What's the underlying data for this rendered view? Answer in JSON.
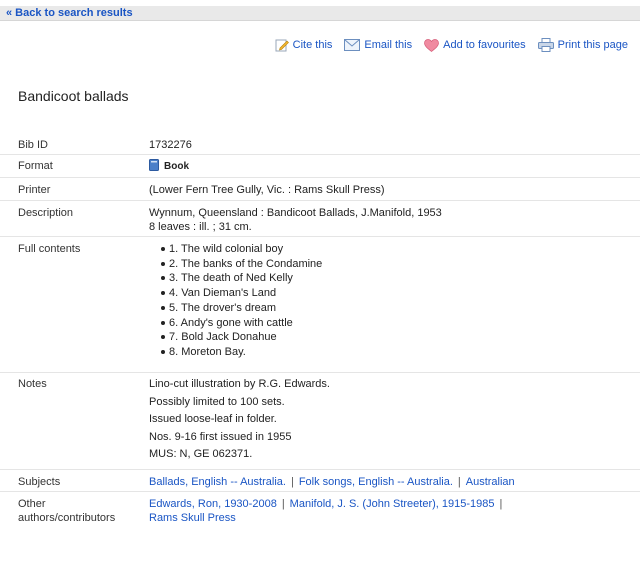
{
  "nav": {
    "back_label": "« Back to search results"
  },
  "actions": [
    {
      "label": "Cite this",
      "icon": "pencil-icon"
    },
    {
      "label": "Email this",
      "icon": "envelope-icon"
    },
    {
      "label": "Add to favourites",
      "icon": "heart-icon"
    },
    {
      "label": "Print this page",
      "icon": "printer-icon"
    }
  ],
  "record": {
    "title": "Bandicoot ballads",
    "fields": {
      "bib_id": {
        "label": "Bib ID",
        "value": "1732276"
      },
      "format": {
        "label": "Format",
        "value": "Book",
        "icon": "book-icon"
      },
      "printer": {
        "label": "Printer",
        "value": "(Lower Fern Tree Gully, Vic. : Rams Skull Press)"
      },
      "description": {
        "label": "Description",
        "lines": [
          "Wynnum, Queensland : Bandicoot Ballads, J.Manifold, 1953",
          "8 leaves : ill. ; 31 cm."
        ]
      },
      "full_contents": {
        "label": "Full contents",
        "items": [
          "1. The wild colonial boy",
          "2. The banks of the Condamine",
          "3. The death of Ned Kelly",
          "4. Van Dieman's Land",
          "5. The drover's dream",
          "6. Andy's gone with cattle",
          "7. Bold Jack Donahue",
          "8. Moreton Bay."
        ]
      },
      "notes": {
        "label": "Notes",
        "lines": [
          "Lino-cut illustration by R.G. Edwards.",
          "Possibly limited to 100 sets.",
          "Issued loose-leaf in folder.",
          "Nos. 9-16 first issued in 1955",
          "MUS: N, GE 062371."
        ]
      },
      "subjects": {
        "label": "Subjects",
        "links": [
          "Ballads, English -- Australia.",
          "Folk songs, English -- Australia.",
          "Australian"
        ]
      },
      "contributors": {
        "label_line1": "Other",
        "label_line2": "authors/contributors",
        "links": [
          "Edwards, Ron, 1930-2008",
          "Manifold, J. S. (John Streeter), 1915-1985",
          "Rams Skull Press"
        ]
      }
    }
  },
  "colors": {
    "link": "#1a55c4",
    "bar": "#e9e9e9",
    "divider": "#e5e5e5"
  }
}
